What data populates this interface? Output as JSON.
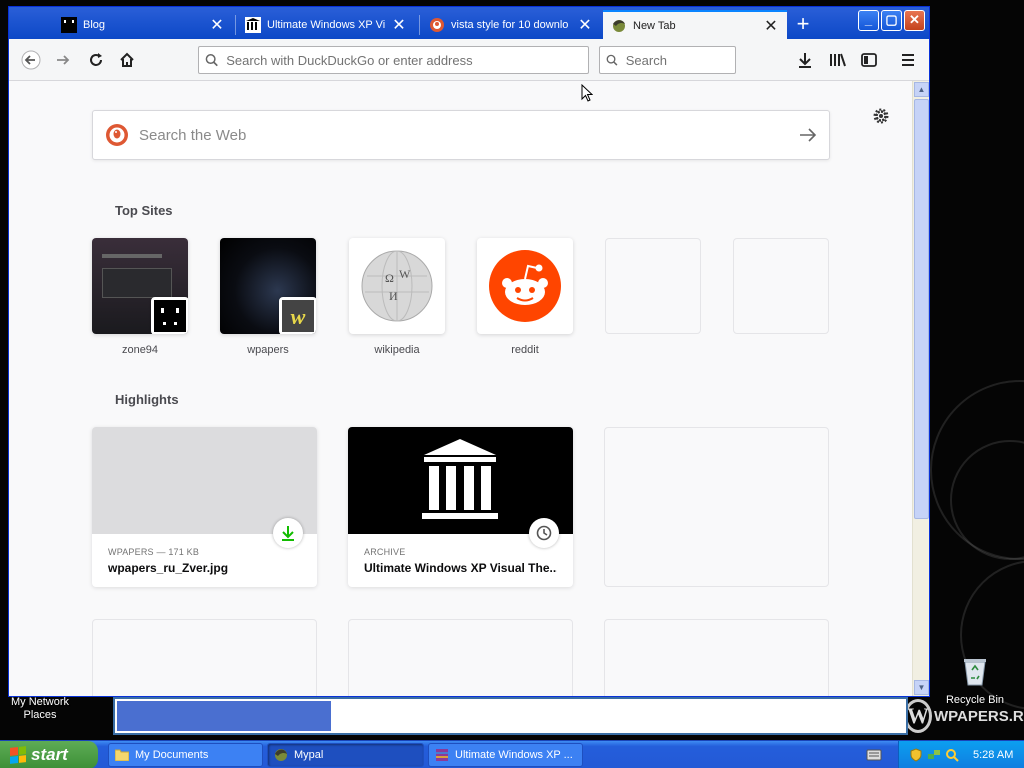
{
  "browser": {
    "tabs": [
      {
        "title": "Blog",
        "favicon": "blog-favicon",
        "active": false
      },
      {
        "title": "Ultimate Windows XP Visual",
        "favicon": "archive-favicon",
        "active": false
      },
      {
        "title": "vista style for 10 downlo",
        "favicon": "duckduckgo-favicon",
        "active": false
      },
      {
        "title": "New Tab",
        "favicon": "firefox-favicon",
        "active": true
      }
    ],
    "url_placeholder": "Search with DuckDuckGo or enter address",
    "search_placeholder": "Search"
  },
  "newtab": {
    "web_search_placeholder": "Search the Web",
    "top_sites_title": "Top Sites",
    "top_sites": [
      {
        "label": "zone94"
      },
      {
        "label": "wpapers"
      },
      {
        "label": "wikipedia"
      },
      {
        "label": "reddit"
      }
    ],
    "highlights_title": "Highlights",
    "highlights": [
      {
        "meta": "WPAPERS — 171 KB",
        "title": "wpapers_ru_Zver.jpg",
        "badge": "download-icon"
      },
      {
        "meta": "ARCHIVE",
        "title": "Ultimate Windows XP Visual The...",
        "badge": "clock-icon"
      }
    ]
  },
  "desktop": {
    "icons": [
      {
        "label": "My Network Places"
      },
      {
        "label": "Recycle Bin"
      }
    ],
    "watermark": "WPAPERS.RU"
  },
  "download_progress": 0.27,
  "taskbar": {
    "start_label": "start",
    "tasks": [
      {
        "label": "My Documents"
      },
      {
        "label": "Mypal"
      },
      {
        "label": "Ultimate Windows XP ..."
      }
    ],
    "clock": "5:28 AM"
  },
  "colors": {
    "xp_blue": "#245edb",
    "start_green": "#3c8f36",
    "reddit_orange": "#ff4500",
    "download_green": "#12bc00"
  }
}
